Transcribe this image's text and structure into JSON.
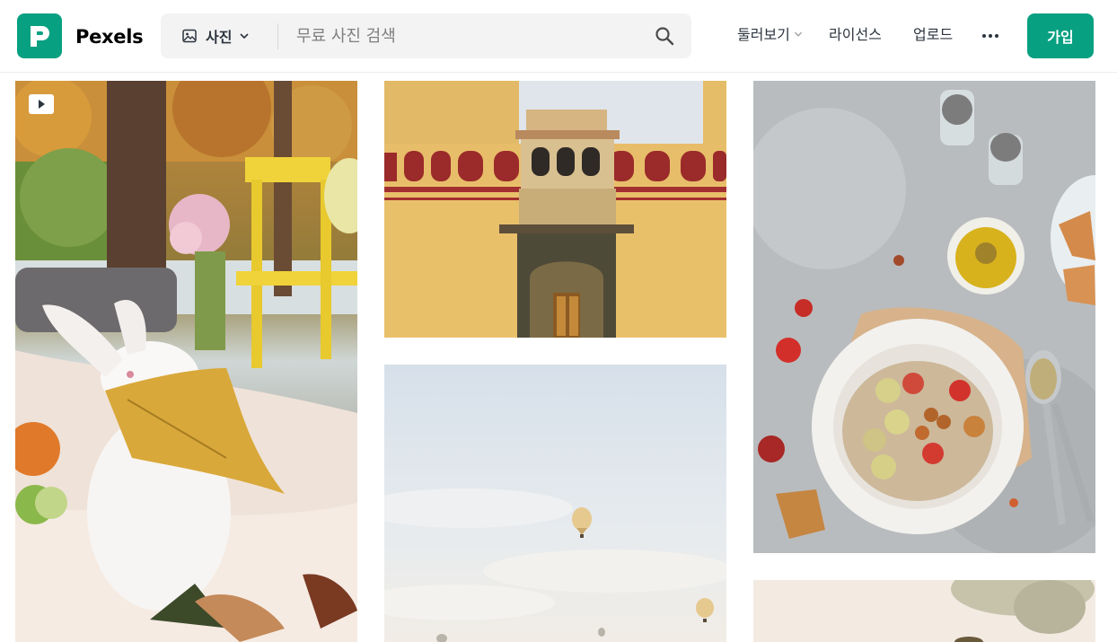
{
  "header": {
    "logo_text": "Pexels",
    "search": {
      "type_label": "사진",
      "placeholder": "무료 사진 검색"
    },
    "nav": {
      "explore": "둘러보기",
      "license": "라이선스",
      "upload": "업로드"
    },
    "join_label": "가입"
  },
  "colors": {
    "brand": "#07a081",
    "text": "#2c343e",
    "search_bg": "#f3f3f3"
  },
  "gallery": {
    "columns": [
      {
        "items": [
          {
            "name": "rabbit-autumn-picnic",
            "media": "video"
          }
        ]
      },
      {
        "items": [
          {
            "name": "palace-gate",
            "media": "photo"
          },
          {
            "name": "hot-air-balloons-sky",
            "media": "photo"
          }
        ]
      },
      {
        "items": [
          {
            "name": "hummus-bowl-table",
            "media": "photo"
          },
          {
            "name": "bright-photo-partial",
            "media": "photo"
          }
        ]
      }
    ]
  }
}
